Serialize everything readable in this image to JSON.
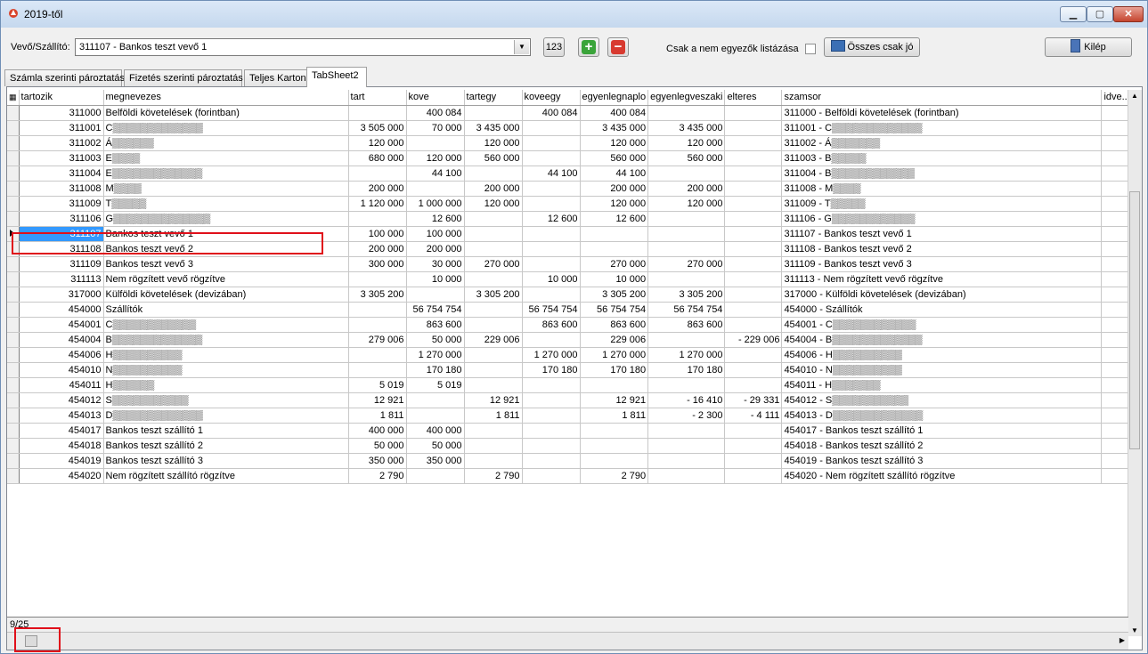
{
  "window": {
    "title": "2019-től"
  },
  "toolbar": {
    "partner_label": "Vevő/Szállító:",
    "partner_value": "311107 - Bankos teszt vevő 1",
    "btn_123": "123",
    "only_unmatched_label": "Csak a nem egyezők listázása",
    "all_ok_label": "Összes csak jó",
    "exit_label": "Kilép"
  },
  "tabs": [
    "Számla szerinti pároztatás",
    "Fizetés szerinti pároztatás",
    "Teljes Karton",
    "TabSheet2"
  ],
  "grid": {
    "columns": [
      "tartozik",
      "megnevezes",
      "tart",
      "kove",
      "tartegy",
      "koveegy",
      "egyenlegnaplo",
      "egyenlegveszaki",
      "elteres",
      "szamsor",
      "idve..."
    ],
    "rows": [
      [
        "311000",
        "Belföldi követelések (forintban)",
        "",
        "400 084",
        "",
        "400 084",
        "400 084",
        "",
        "",
        "311000 - Belföldi követelések (forintban)"
      ],
      [
        "311001",
        "C▒▒▒▒▒▒▒▒▒▒▒▒▒",
        "3 505 000",
        "70 000",
        "3 435 000",
        "",
        "3 435 000",
        "3 435 000",
        "",
        "311001 - C▒▒▒▒▒▒▒▒▒▒▒▒▒"
      ],
      [
        "311002",
        "Á▒▒▒▒▒▒",
        "120 000",
        "",
        "120 000",
        "",
        "120 000",
        "120 000",
        "",
        "311002 - Á▒▒▒▒▒▒▒"
      ],
      [
        "311003",
        "E▒▒▒▒",
        "680 000",
        "120 000",
        "560 000",
        "",
        "560 000",
        "560 000",
        "",
        "311003 - B▒▒▒▒▒"
      ],
      [
        "311004",
        "E▒▒▒▒▒▒▒▒▒▒▒▒▒",
        "",
        "44 100",
        "",
        "44 100",
        "44 100",
        "",
        "",
        "311004 - B▒▒▒▒▒▒▒▒▒▒▒▒"
      ],
      [
        "311008",
        "M▒▒▒▒",
        "200 000",
        "",
        "200 000",
        "",
        "200 000",
        "200 000",
        "",
        "311008 - M▒▒▒▒"
      ],
      [
        "311009",
        "T▒▒▒▒▒",
        "1 120 000",
        "1 000 000",
        "120 000",
        "",
        "120 000",
        "120 000",
        "",
        "311009 - T▒▒▒▒▒"
      ],
      [
        "311106",
        "G▒▒▒▒▒▒▒▒▒▒▒▒▒▒",
        "",
        "12 600",
        "",
        "12 600",
        "12 600",
        "",
        "",
        "311106 - G▒▒▒▒▒▒▒▒▒▒▒▒"
      ],
      [
        "311107",
        "Bankos teszt vevő 1",
        "100 000",
        "100 000",
        "",
        "",
        "",
        "",
        "",
        "311107 - Bankos teszt vevő 1"
      ],
      [
        "311108",
        "Bankos teszt vevő 2",
        "200 000",
        "200 000",
        "",
        "",
        "",
        "",
        "",
        "311108 - Bankos teszt vevő 2"
      ],
      [
        "311109",
        "Bankos teszt vevő 3",
        "300 000",
        "30 000",
        "270 000",
        "",
        "270 000",
        "270 000",
        "",
        "311109 - Bankos teszt vevő 3"
      ],
      [
        "311113",
        "Nem rögzített vevő rögzítve",
        "",
        "10 000",
        "",
        "10 000",
        "10 000",
        "",
        "",
        "311113 - Nem rögzített vevő rögzítve"
      ],
      [
        "317000",
        "Külföldi követelések (devizában)",
        "3 305 200",
        "",
        "3 305 200",
        "",
        "3 305 200",
        "3 305 200",
        "",
        "317000 - Külföldi követelések (devizában)"
      ],
      [
        "454000",
        "Szállítók",
        "",
        "56 754 754",
        "",
        "56 754 754",
        "56 754 754",
        "56 754 754",
        "",
        "454000 - Szállítók"
      ],
      [
        "454001",
        "C▒▒▒▒▒▒▒▒▒▒▒▒",
        "",
        "863 600",
        "",
        "863 600",
        "863 600",
        "863 600",
        "",
        "454001 - C▒▒▒▒▒▒▒▒▒▒▒▒"
      ],
      [
        "454004",
        "B▒▒▒▒▒▒▒▒▒▒▒▒▒",
        "279 006",
        "50 000",
        "229 006",
        "",
        "229 006",
        "",
        "- 229 006",
        "454004 - B▒▒▒▒▒▒▒▒▒▒▒▒▒"
      ],
      [
        "454006",
        "H▒▒▒▒▒▒▒▒▒▒",
        "",
        "1 270 000",
        "",
        "1 270 000",
        "1 270 000",
        "1 270 000",
        "",
        "454006 - H▒▒▒▒▒▒▒▒▒▒"
      ],
      [
        "454010",
        "N▒▒▒▒▒▒▒▒▒▒",
        "",
        "170 180",
        "",
        "170 180",
        "170 180",
        "170 180",
        "",
        "454010 - N▒▒▒▒▒▒▒▒▒▒"
      ],
      [
        "454011",
        "H▒▒▒▒▒▒",
        "5 019",
        "5 019",
        "",
        "",
        "",
        "",
        "",
        "454011 - H▒▒▒▒▒▒▒"
      ],
      [
        "454012",
        "S▒▒▒▒▒▒▒▒▒▒▒",
        "12 921",
        "",
        "12 921",
        "",
        "12 921",
        "- 16 410",
        "- 29 331",
        "454012 - S▒▒▒▒▒▒▒▒▒▒▒"
      ],
      [
        "454013",
        "D▒▒▒▒▒▒▒▒▒▒▒▒▒",
        "1 811",
        "",
        "1 811",
        "",
        "1 811",
        "- 2 300",
        "- 4 111",
        "454013 - D▒▒▒▒▒▒▒▒▒▒▒▒▒"
      ],
      [
        "454017",
        "Bankos teszt szállító 1",
        "400 000",
        "400 000",
        "",
        "",
        "",
        "",
        "",
        "454017 - Bankos teszt szállító 1"
      ],
      [
        "454018",
        "Bankos teszt szállító 2",
        "50 000",
        "50 000",
        "",
        "",
        "",
        "",
        "",
        "454018 - Bankos teszt szállító 2"
      ],
      [
        "454019",
        "Bankos teszt szállító 3",
        "350 000",
        "350 000",
        "",
        "",
        "",
        "",
        "",
        "454019 - Bankos teszt szállító 3"
      ],
      [
        "454020",
        "Nem rögzített szállító rögzítve",
        "2 790",
        "",
        "2 790",
        "",
        "2 790",
        "",
        "",
        "454020 - Nem rögzített szállító rögzítve"
      ]
    ],
    "selected_row": 8
  },
  "status": {
    "record_position": "9/25"
  },
  "colors": {
    "selection": "#3399ff",
    "highlight_box": "#e0101a"
  }
}
